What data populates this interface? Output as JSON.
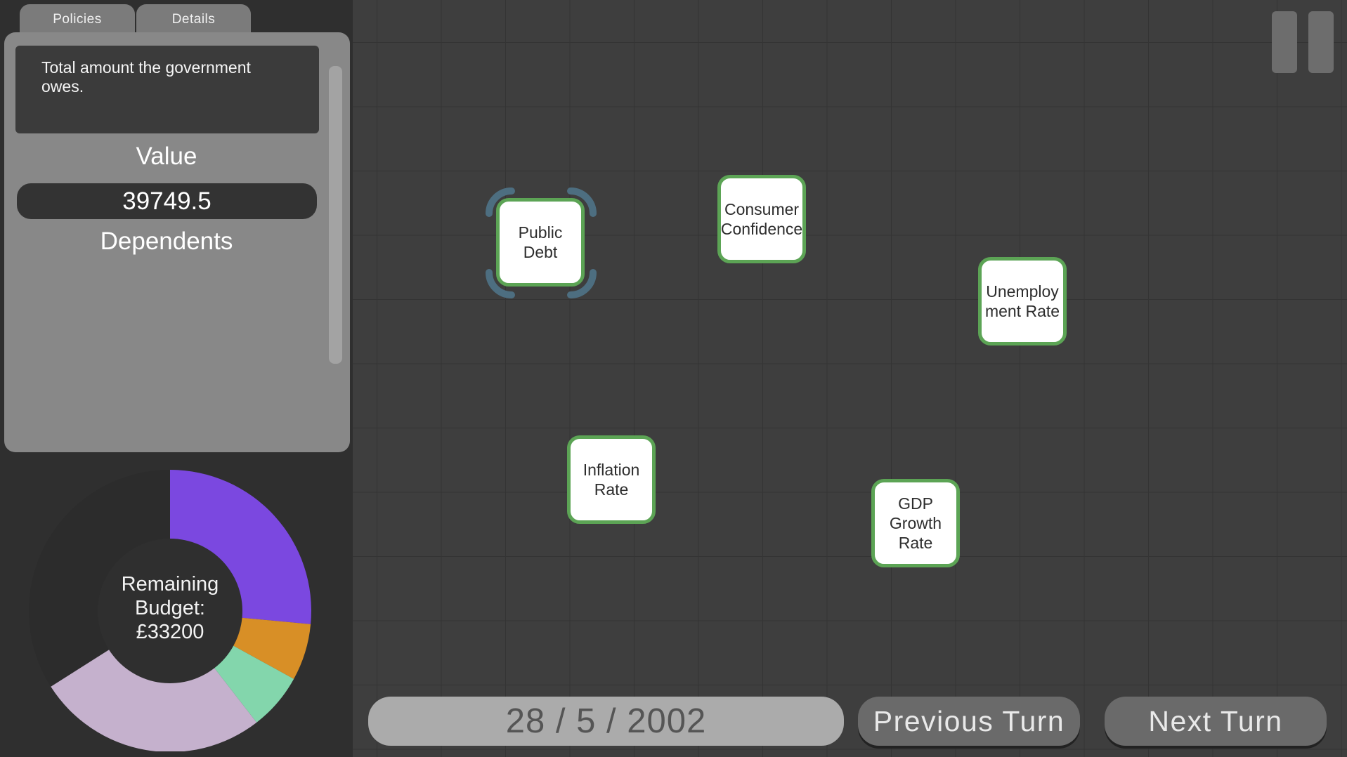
{
  "tabs": [
    {
      "label": "Policies"
    },
    {
      "label": "Details"
    }
  ],
  "details": {
    "description": "Total amount the government owes.",
    "value_label": "Value",
    "value": "39749.5",
    "dependents_label": "Dependents"
  },
  "budget": {
    "label_line1": "Remaining",
    "label_line2": "Budget:",
    "label_line3": "£33200",
    "segments": [
      {
        "name": "purple",
        "color": "#7b48e0",
        "fraction": 0.265
      },
      {
        "name": "orange",
        "color": "#d88f26",
        "fraction": 0.065
      },
      {
        "name": "mint",
        "color": "#83d6ac",
        "fraction": 0.065
      },
      {
        "name": "lilac",
        "color": "#c5b1cd",
        "fraction": 0.265
      },
      {
        "name": "remaining",
        "color": "#2c2c2c",
        "fraction": 0.34
      }
    ]
  },
  "nodes": {
    "public_debt": {
      "label": "Public Debt",
      "selected": true
    },
    "consumer_confidence": {
      "label": "Consumer Confidence"
    },
    "unemployment_rate": {
      "label": "Unemploy ment Rate"
    },
    "inflation_rate": {
      "label": "Inflation Rate"
    },
    "gdp_growth_rate": {
      "label": "GDP Growth Rate"
    }
  },
  "colors": {
    "node_border": "#5ca455",
    "selection_ring": "#4d6e80"
  },
  "bottom": {
    "date": "28 / 5 / 2002",
    "previous_turn": "Previous Turn",
    "next_turn": "Next Turn"
  }
}
